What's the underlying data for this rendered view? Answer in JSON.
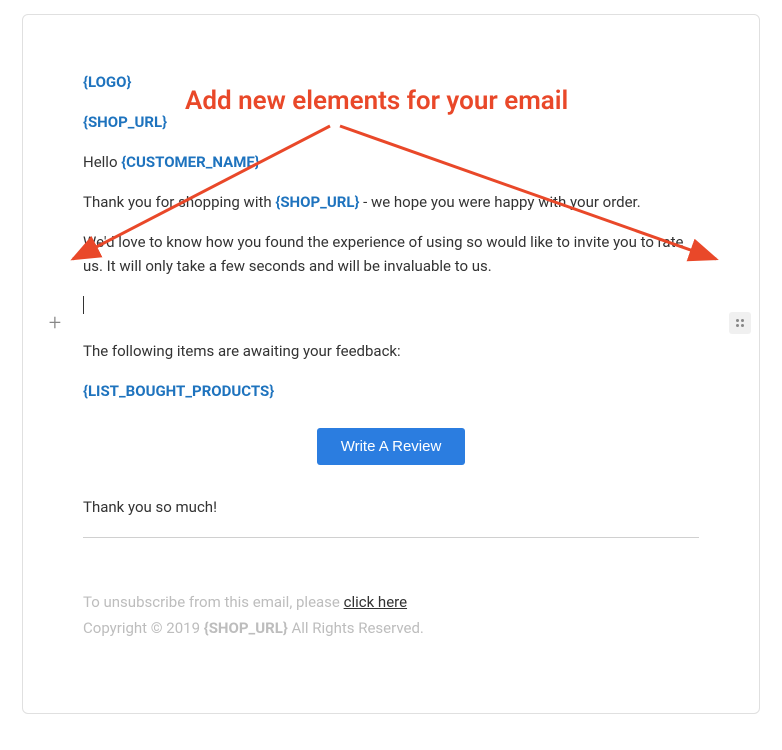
{
  "template": {
    "logo": "{LOGO}",
    "shop_url": "{SHOP_URL}",
    "greeting_prefix": "Hello ",
    "customer_name_token": "{CUSTOMER_NAME}",
    "thank_you_prefix": "Thank you for shopping with ",
    "shop_url_token_inline": "{SHOP_URL}",
    "thank_you_suffix": " - we hope you were happy with your order.",
    "invite_text": "We'd love to know how you found the experience of using so would like to invite you to rate us. It will only take a few seconds and will be invaluable to us.",
    "awaiting_feedback": "The following items are awaiting your feedback:",
    "list_products_token": "{LIST_BOUGHT_PRODUCTS}",
    "cta_label": "Write A Review",
    "thanks_closing": "Thank you so much!",
    "unsubscribe_prefix": "To unsubscribe from this email, please ",
    "unsubscribe_link": "click here",
    "copyright_prefix": "Copyright © 2019 ",
    "copyright_shop_token": "{SHOP_URL}",
    "copyright_suffix": " All Rights Reserved."
  },
  "annotation": {
    "callout_text": "Add new elements for your email"
  }
}
